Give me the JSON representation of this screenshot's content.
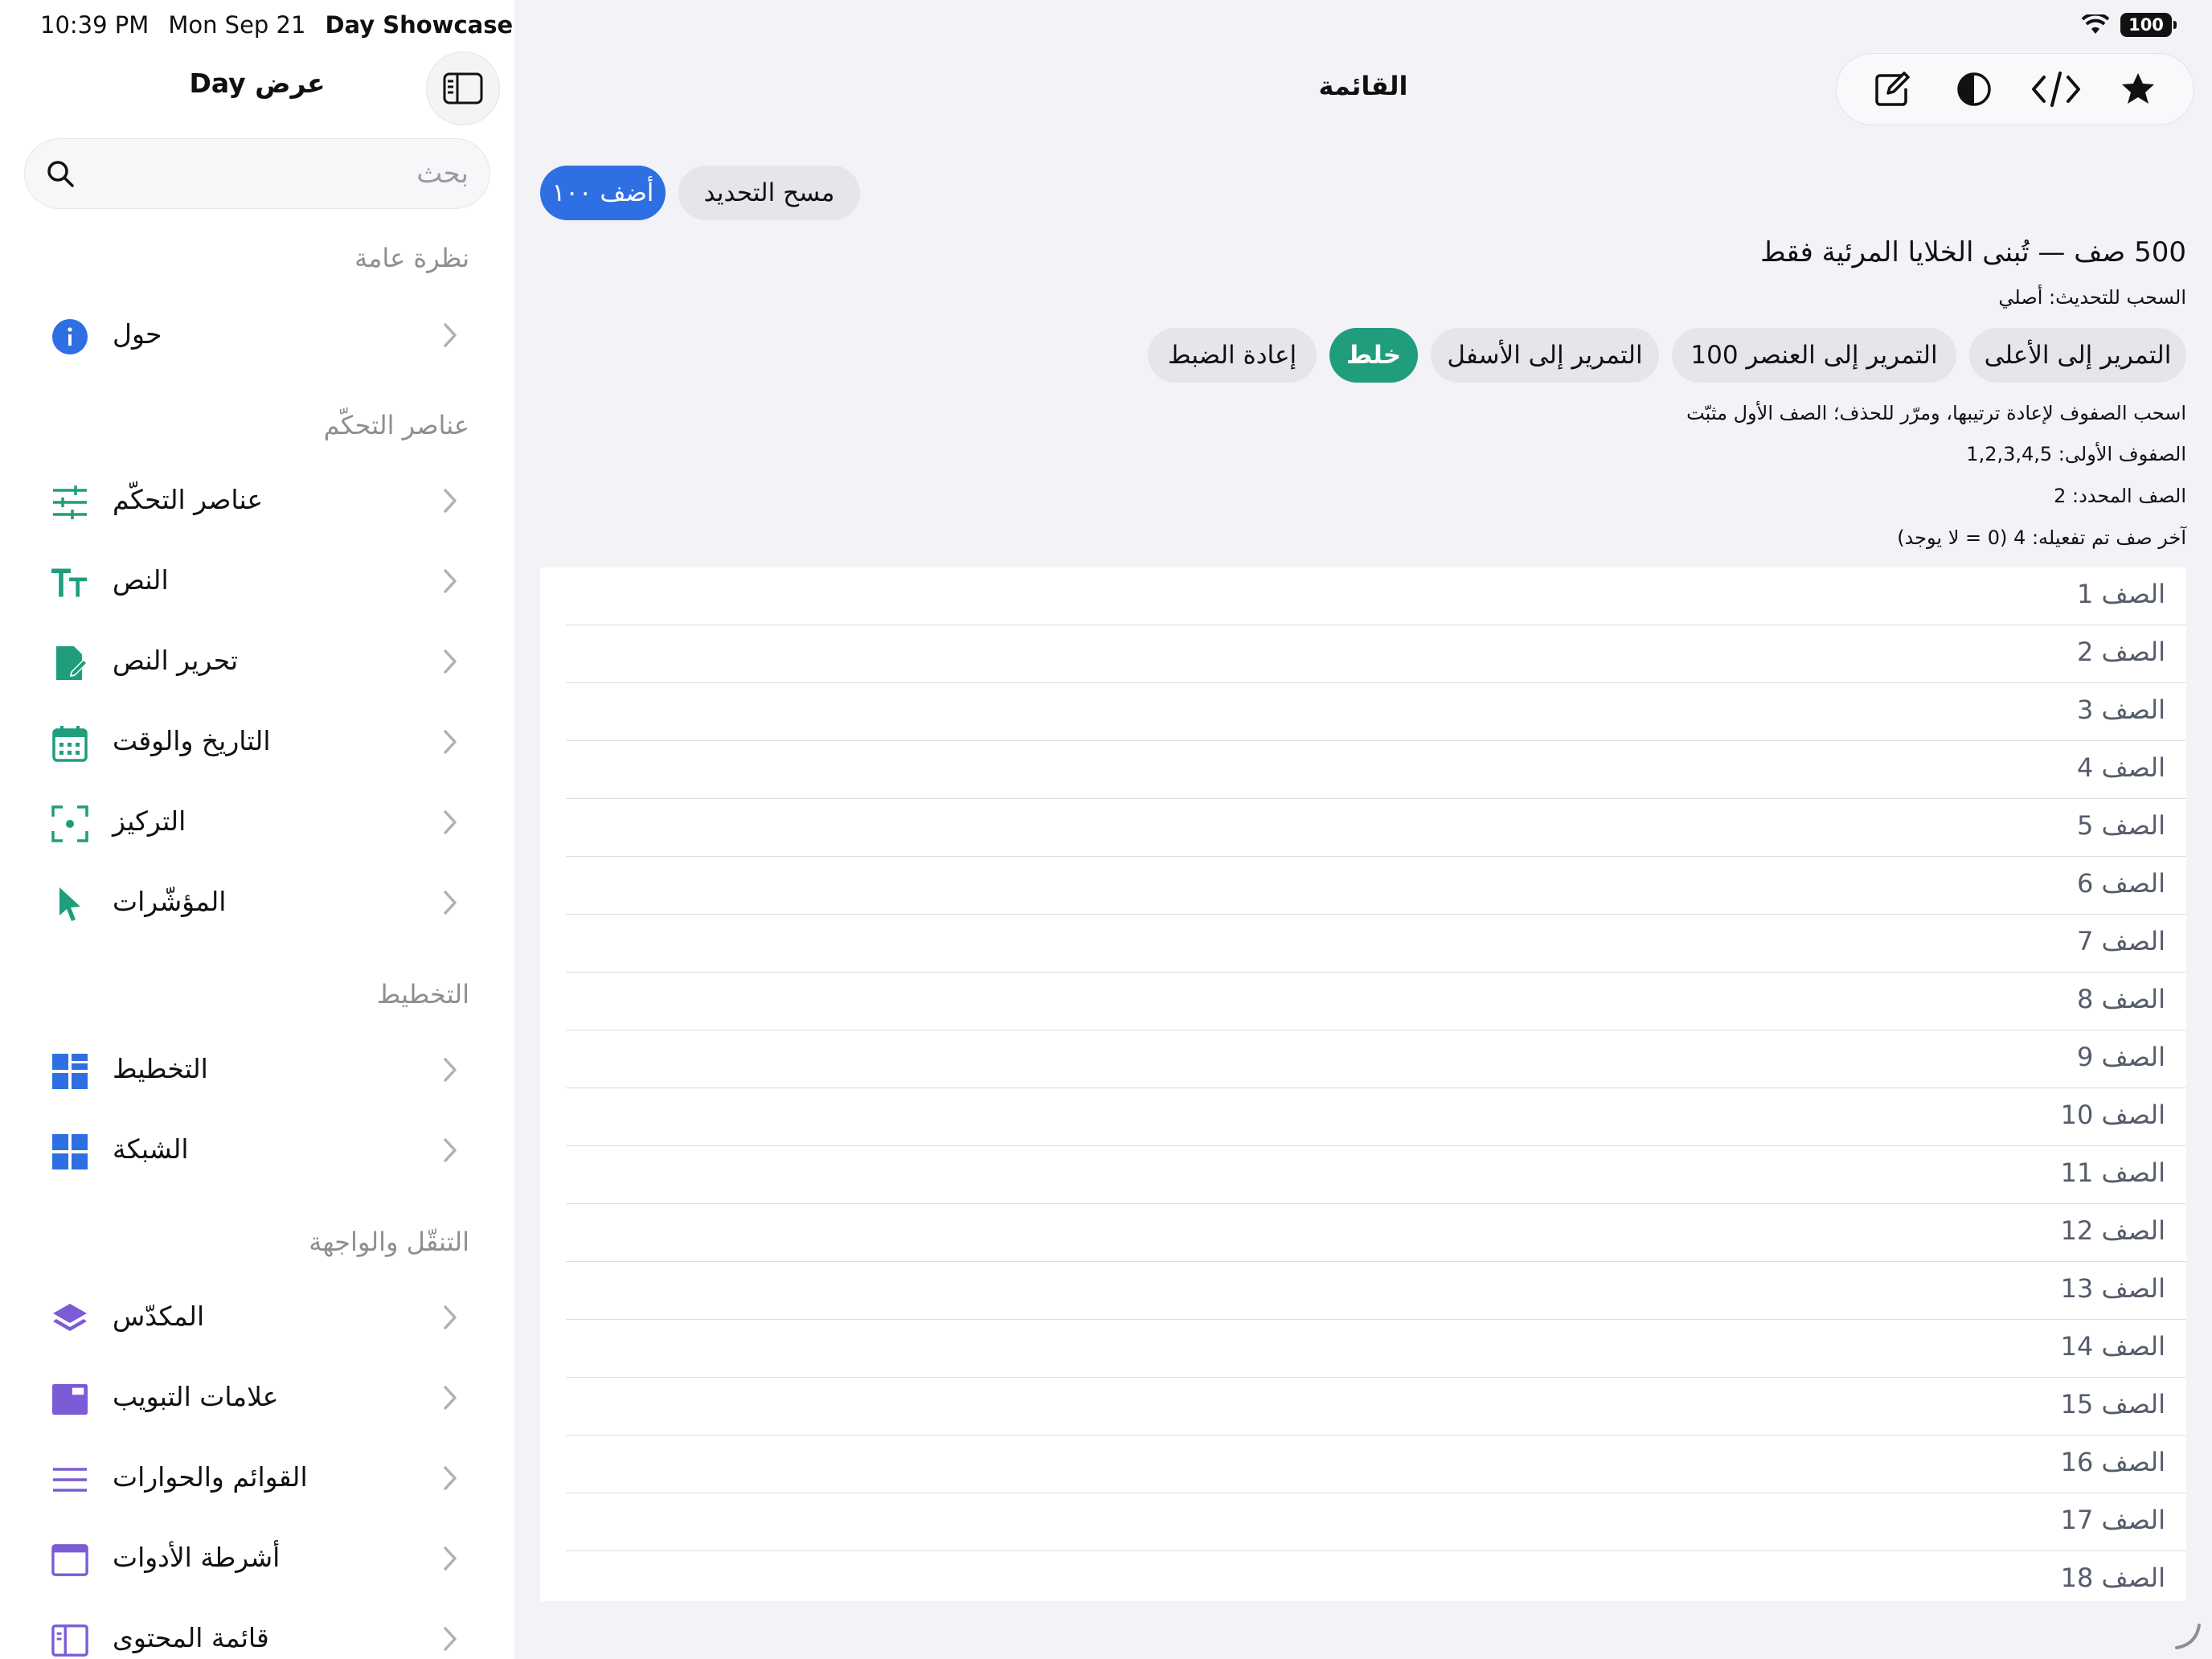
{
  "status": {
    "time": "10:39 PM",
    "date": "Mon Sep 21",
    "app": "Day Showcase",
    "battery": "100"
  },
  "sidebar": {
    "title": "عرض Day",
    "search_placeholder": "بحث",
    "sections": [
      {
        "title": "نظرة عامة",
        "items": [
          {
            "label": "حول",
            "icon": "info-icon"
          }
        ]
      },
      {
        "title": "عناصر التحكّم",
        "items": [
          {
            "label": "عناصر التحكّم",
            "icon": "sliders-icon"
          },
          {
            "label": "النص",
            "icon": "text-size-icon"
          },
          {
            "label": "تحرير النص",
            "icon": "document-edit-icon"
          },
          {
            "label": "التاريخ والوقت",
            "icon": "calendar-icon"
          },
          {
            "label": "التركيز",
            "icon": "focus-viewfinder-icon"
          },
          {
            "label": "المؤشّرات",
            "icon": "pointer-icon"
          }
        ]
      },
      {
        "title": "التخطيط",
        "items": [
          {
            "label": "التخطيط",
            "icon": "layout-icon"
          },
          {
            "label": "الشبكة",
            "icon": "grid-icon"
          }
        ]
      },
      {
        "title": "التنقّل والواجهة",
        "items": [
          {
            "label": "المكدّس",
            "icon": "stack-layers-icon"
          },
          {
            "label": "علامات التبويب",
            "icon": "tabs-icon"
          },
          {
            "label": "القوائم والحوارات",
            "icon": "menu-lines-icon"
          },
          {
            "label": "أشرطة الأدوات",
            "icon": "toolbar-window-icon"
          },
          {
            "label": "قائمة المحتوى",
            "icon": "sidebar-content-icon"
          }
        ]
      }
    ]
  },
  "main": {
    "title": "القائمة",
    "toolbar_icons": [
      "compose-icon",
      "contrast-icon",
      "code-icon",
      "star-icon"
    ],
    "buttons_top": {
      "add": "أضف ١٠٠",
      "clear": "مسح التحديد"
    },
    "headline": "500 صف — تُبنى الخلايا المرئية فقط",
    "refresh_label": "السحب للتحديث: أصلي",
    "actions": {
      "top": "التمرير إلى الأعلى",
      "to100": "التمرير إلى العنصر 100",
      "bottom": "التمرير إلى الأسفل",
      "shuffle": "خلط",
      "reset": "إعادة الضبط"
    },
    "hint": "اسحب الصفوف لإعادة ترتيبها، ومرّر للحذف؛ الصف الأول مثبّت",
    "first_rows": "الصفوف الأولى: 1,2,3,4,5",
    "selected_row": "الصف المحدد: 2",
    "last_activated": "آخر صف تم تفعيله: 4 (0 = لا يوجد)",
    "rows": [
      "الصف 1",
      "الصف 2",
      "الصف 3",
      "الصف 4",
      "الصف 5",
      "الصف 6",
      "الصف 7",
      "الصف 8",
      "الصف 9",
      "الصف 10",
      "الصف 11",
      "الصف 12",
      "الصف 13",
      "الصف 14",
      "الصف 15",
      "الصف 16",
      "الصف 17",
      "الصف 18"
    ]
  },
  "colors": {
    "accent_blue": "#2f6fe4",
    "accent_green": "#1f9d7c",
    "icon_teal": "#1f9d7c",
    "icon_blue": "#2f6fe4",
    "icon_purple": "#7b5bd6"
  }
}
